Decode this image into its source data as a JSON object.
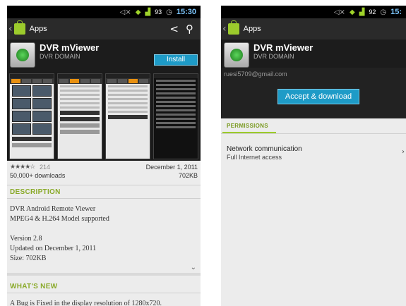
{
  "left": {
    "status": {
      "clock": "15:30",
      "battery": "93"
    },
    "actionbar": {
      "title": "Apps"
    },
    "app": {
      "name": "DVR mViewer",
      "developer": "DVR DOMAIN",
      "install_label": "Install"
    },
    "meta": {
      "stars": "★★★★☆",
      "rating_count": "214",
      "downloads": "50,000+ downloads",
      "date": "December 1, 2011",
      "size": "702KB"
    },
    "description": {
      "heading": "DESCRIPTION",
      "line1": "DVR Android Remote Viewer",
      "line2": "MPEG4 & H.264 Model supported",
      "version": "Version 2.8",
      "updated": "Updated on December 1, 2011",
      "size": "Size: 702KB"
    },
    "whatsnew": {
      "heading": "WHAT'S NEW",
      "text": "A Bug is Fixed in the display resolution of 1280x720."
    }
  },
  "right": {
    "status": {
      "clock": "15:",
      "battery": "92"
    },
    "actionbar": {
      "title": "Apps"
    },
    "app": {
      "name": "DVR mViewer",
      "developer": "DVR DOMAIN"
    },
    "email": "ruesi5709@gmail.com",
    "accept_label": "Accept & download",
    "permissions_tab": "PERMISSIONS",
    "permission": {
      "title": "Network communication",
      "subtitle": "Full Internet access"
    }
  },
  "icons": [
    "back-icon",
    "play-store-bag-icon",
    "share-icon",
    "search-icon",
    "mute-icon",
    "wifi-icon",
    "signal-icon",
    "alarm-icon",
    "chevron-down-icon",
    "chevron-right-icon"
  ],
  "colors": {
    "accent_blue": "#1e9bc7",
    "accent_green": "#9ccb2c",
    "section_green": "#8aaa2a"
  }
}
